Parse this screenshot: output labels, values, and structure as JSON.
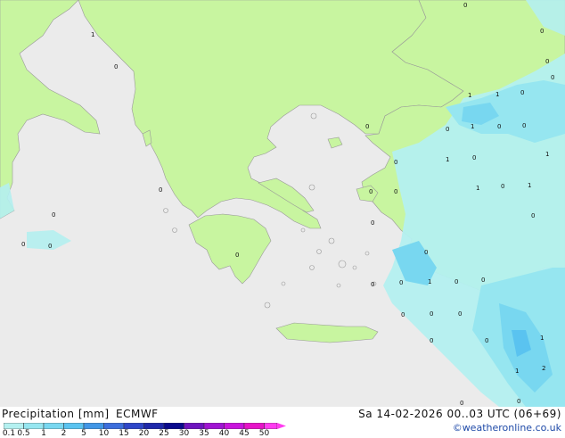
{
  "map": {
    "precip_labels": [
      "0",
      "0",
      "1",
      "0",
      "0",
      "0",
      "1",
      "1",
      "0",
      "0",
      "0",
      "0",
      "0",
      "1",
      "1",
      "0",
      "1",
      "1",
      "0",
      "0",
      "0",
      "0",
      "1",
      "0",
      "0",
      "0",
      "0",
      "0",
      "0",
      "0",
      "0",
      "0",
      "0",
      "1",
      "0",
      "0",
      "0",
      "0",
      "0",
      "0",
      "1",
      "1",
      "2",
      "0",
      "0",
      "0"
    ]
  },
  "legend": {
    "title": "Precipitation [mm]",
    "model": "ECMWF",
    "datetime": "Sa 14-02-2026 00..03 UTC (06+69)",
    "credit": "©weatheronline.co.uk",
    "ticks": [
      "0.1",
      "0.5",
      "1",
      "2",
      "5",
      "10",
      "15",
      "20",
      "25",
      "30",
      "35",
      "40",
      "45",
      "50"
    ],
    "colors": [
      "#b4f0f0",
      "#96e6f0",
      "#78d7f0",
      "#5ac3f0",
      "#4196e6",
      "#3c6edc",
      "#2e46c8",
      "#1e28aa",
      "#0a0a8c",
      "#6e14be",
      "#a014d2",
      "#c814dc",
      "#e614c8",
      "#ff3cf0"
    ],
    "land_color": "#c8f5a0",
    "sea_color": "#ebebeb"
  }
}
